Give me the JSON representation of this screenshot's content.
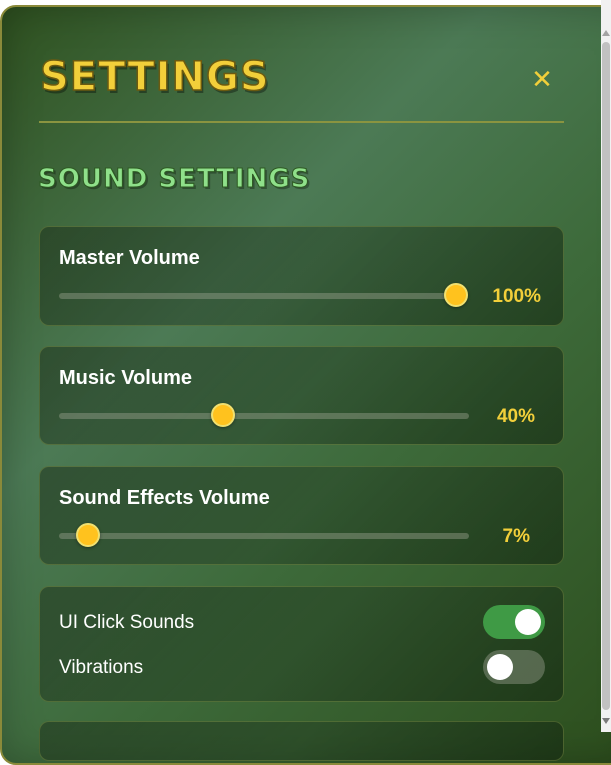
{
  "settings": {
    "title": "SETTINGS",
    "close_icon": "close-icon",
    "close_symbol": "✕",
    "section_title": "SOUND SETTINGS",
    "colors": {
      "accent_yellow": "#f2cf3a",
      "section_green": "#8fe08a",
      "toggle_on": "#3f9a45",
      "slider_thumb": "#ffc21e"
    },
    "sliders": [
      {
        "label": "Master Volume",
        "value": 100,
        "value_text": "100%"
      },
      {
        "label": "Music Volume",
        "value": 40,
        "value_text": "40%"
      },
      {
        "label": "Sound Effects Volume",
        "value": 7,
        "value_text": "7%"
      }
    ],
    "toggles": [
      {
        "label": "UI Click Sounds",
        "on": true
      },
      {
        "label": "Vibrations",
        "on": false
      }
    ]
  }
}
